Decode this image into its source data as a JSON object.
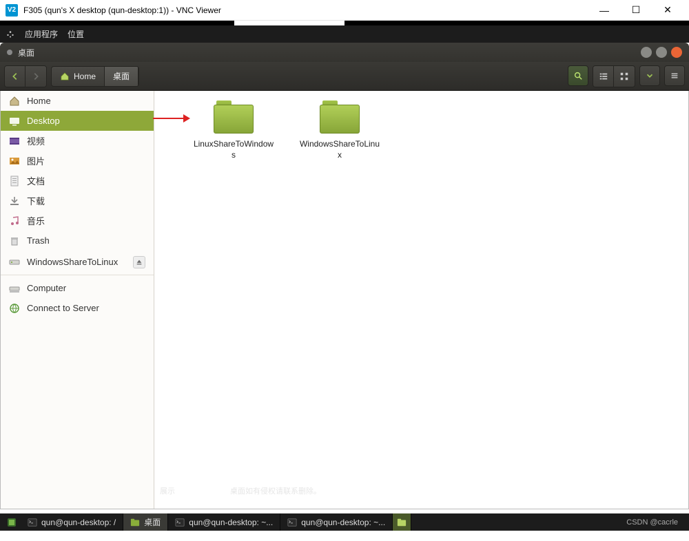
{
  "vnc": {
    "logo_text": "V2",
    "title": "F305 (qun's X desktop (qun-desktop:1)) - VNC Viewer",
    "minimize": "—",
    "maximize": "☐",
    "close": "✕"
  },
  "gnome_panel": {
    "apps": "应用程序",
    "places": "位置"
  },
  "fm": {
    "window_title": "桌面",
    "breadcrumb_home": "Home",
    "breadcrumb_current": "桌面"
  },
  "sidebar": {
    "items": [
      {
        "label": "Home",
        "icon": "home"
      },
      {
        "label": "Desktop",
        "icon": "desktop",
        "active": true
      },
      {
        "label": "视频",
        "icon": "videos"
      },
      {
        "label": "图片",
        "icon": "pictures"
      },
      {
        "label": "文档",
        "icon": "documents"
      },
      {
        "label": "下载",
        "icon": "downloads"
      },
      {
        "label": "音乐",
        "icon": "music"
      },
      {
        "label": "Trash",
        "icon": "trash"
      }
    ],
    "mounts": [
      {
        "label": "WindowsShareToLinux",
        "icon": "network-drive",
        "ejectable": true
      }
    ],
    "computer": {
      "label": "Computer"
    },
    "connect": {
      "label": "Connect to Server"
    }
  },
  "folders": [
    {
      "name": "LinuxShareToWindows"
    },
    {
      "name": "WindowsShareToLinux"
    }
  ],
  "taskbar": {
    "items": [
      {
        "label": "qun@qun-desktop: /",
        "icon": "terminal"
      },
      {
        "label": "桌面",
        "icon": "file-manager",
        "active": true
      },
      {
        "label": "qun@qun-desktop: ~...",
        "icon": "terminal"
      },
      {
        "label": "qun@qun-desktop: ~...",
        "icon": "terminal"
      }
    ],
    "tray_fm": "file-manager",
    "watermark": "CSDN @cacrle"
  },
  "ghost": {
    "g2": "展示",
    "g3": "桌面如有侵权请联系删除。"
  }
}
